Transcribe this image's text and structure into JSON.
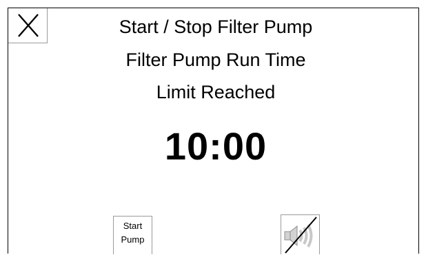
{
  "close_button": {
    "label": "X",
    "icon": "close-icon"
  },
  "message": {
    "line1": "Start / Stop Filter Pump",
    "line2": "Filter Pump Run Time",
    "line3": "Limit Reached"
  },
  "timer": {
    "value": "10:00"
  },
  "start_button": {
    "line1": "Start",
    "line2": "Pump"
  },
  "mute_button": {
    "icon": "speaker-muted-icon"
  },
  "colors": {
    "background": "#ffffff",
    "text": "#000000",
    "border": "#9a9a9a",
    "icon_gray": "#c8c8c8"
  }
}
